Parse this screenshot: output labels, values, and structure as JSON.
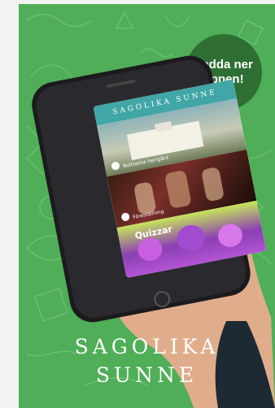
{
  "badge": {
    "line1": "Ladda ner",
    "line2": "appen!"
  },
  "app": {
    "header": "SAGOLIKA SUNNE",
    "cards": [
      {
        "label": "Rottneros herrgård"
      },
      {
        "label": "Föreställning"
      },
      {
        "label": "Quizzar"
      }
    ]
  },
  "title": {
    "line1": "SAGOLIKA",
    "line2": "SUNNE"
  },
  "colors": {
    "background": "#4fae57",
    "badge": "#2f6f34",
    "app_header": "#41a6a6"
  }
}
